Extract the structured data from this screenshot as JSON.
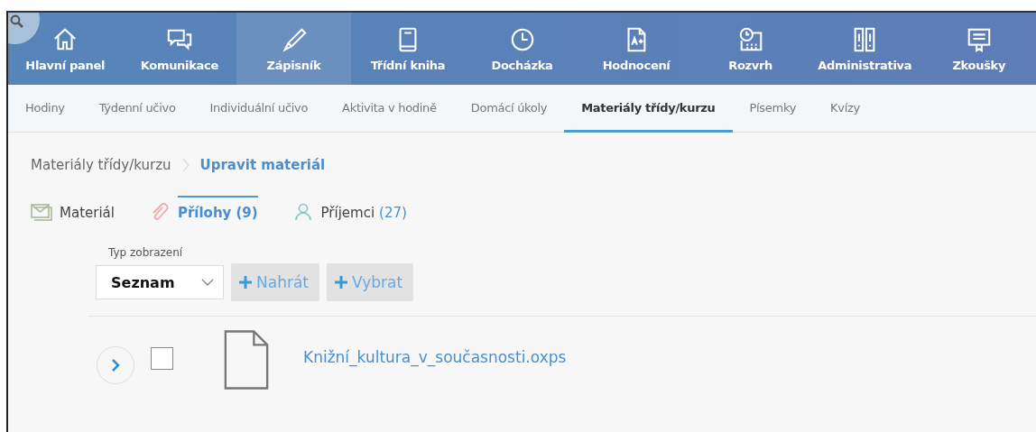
{
  "main_nav": [
    {
      "label": "Hlavní panel",
      "selected": false
    },
    {
      "label": "Komunikace",
      "selected": false
    },
    {
      "label": "Zápisník",
      "selected": true
    },
    {
      "label": "Třídní kniha",
      "selected": false
    },
    {
      "label": "Docházka",
      "selected": false
    },
    {
      "label": "Hodnocení",
      "selected": false
    },
    {
      "label": "Rozvrh",
      "selected": false
    },
    {
      "label": "Administrativa",
      "selected": false
    },
    {
      "label": "Zkoušky",
      "selected": false
    }
  ],
  "sub_nav": [
    {
      "label": "Hodiny",
      "selected": false
    },
    {
      "label": "Týdenní učivo",
      "selected": false
    },
    {
      "label": "Individuální učivo",
      "selected": false
    },
    {
      "label": "Aktivita v hodině",
      "selected": false
    },
    {
      "label": "Domácí úkoly",
      "selected": false
    },
    {
      "label": "Materiály třídy/kurzu",
      "selected": true
    },
    {
      "label": "Písemky",
      "selected": false
    },
    {
      "label": "Kvízy",
      "selected": false
    }
  ],
  "breadcrumb": [
    "Materiály třídy/kurzu",
    "Upravit materiál"
  ],
  "tabs": [
    {
      "label": "Materiál",
      "selected": false
    },
    {
      "label": "Přílohy",
      "count": "(9)",
      "selected": true
    },
    {
      "label": "Příjemci",
      "count": "(27)",
      "selected": false
    }
  ],
  "view_type": {
    "label": "Typ zobrazení",
    "value": "Seznam"
  },
  "buttons": [
    "Nahrát",
    "Vybrat"
  ],
  "files": [
    {
      "name": "Knižní_kultura_v_současnosti.oxps",
      "checked": false
    }
  ]
}
